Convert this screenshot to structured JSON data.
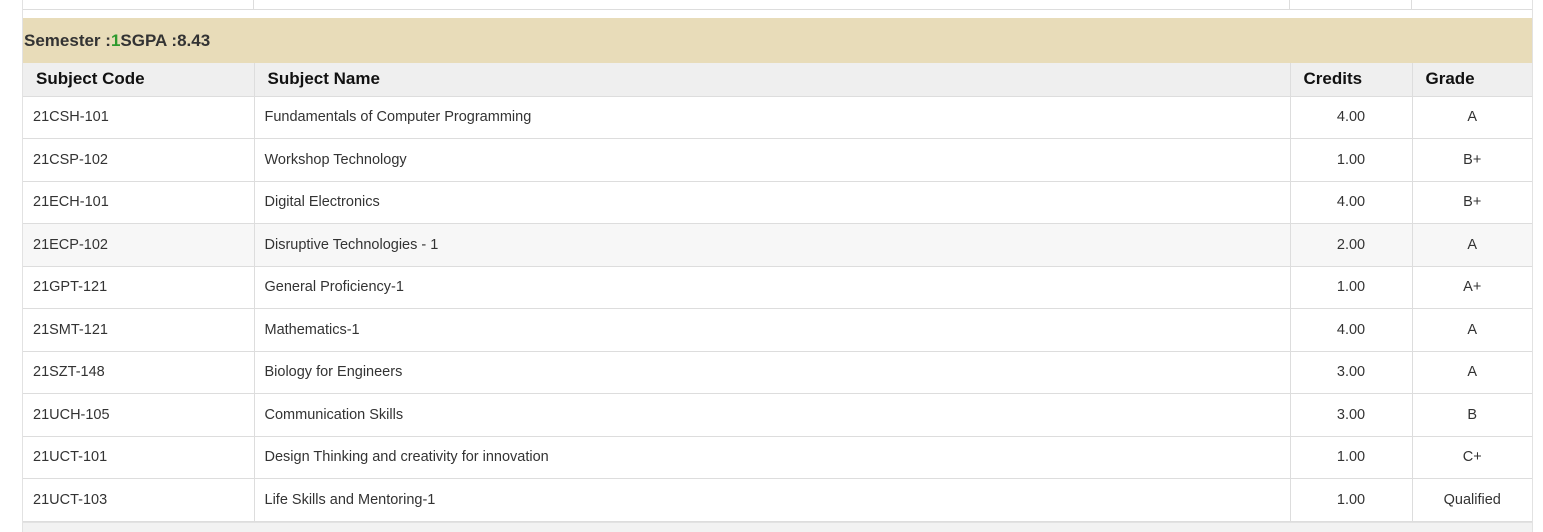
{
  "semester": {
    "label": "Semester : ",
    "number": "1",
    "sgpa_label": " SGPA : ",
    "sgpa_value": "8.43"
  },
  "table": {
    "headers": {
      "code": "Subject Code",
      "name": "Subject Name",
      "credits": "Credits",
      "grade": "Grade"
    },
    "rows": [
      {
        "code": "21CSH-101",
        "name": "Fundamentals of Computer Programming",
        "credits": "4.00",
        "grade": "A"
      },
      {
        "code": "21CSP-102",
        "name": "Workshop Technology",
        "credits": "1.00",
        "grade": "B+"
      },
      {
        "code": "21ECH-101",
        "name": "Digital Electronics",
        "credits": "4.00",
        "grade": "B+"
      },
      {
        "code": "21ECP-102",
        "name": "Disruptive Technologies - 1",
        "credits": "2.00",
        "grade": "A"
      },
      {
        "code": "21GPT-121",
        "name": "General Proficiency-1",
        "credits": "1.00",
        "grade": "A+"
      },
      {
        "code": "21SMT-121",
        "name": "Mathematics-1",
        "credits": "4.00",
        "grade": "A"
      },
      {
        "code": "21SZT-148",
        "name": "Biology for Engineers",
        "credits": "3.00",
        "grade": "A"
      },
      {
        "code": "21UCH-105",
        "name": "Communication Skills",
        "credits": "3.00",
        "grade": "B"
      },
      {
        "code": "21UCT-101",
        "name": "Design Thinking and creativity for innovation",
        "credits": "1.00",
        "grade": "C+"
      },
      {
        "code": "21UCT-103",
        "name": "Life Skills and Mentoring-1",
        "credits": "1.00",
        "grade": "Qualified"
      }
    ]
  },
  "colors": {
    "header_band": "#e8dcb9",
    "semester_number": "#2e9a2e",
    "column_header_bg": "#efefef",
    "hover_row_bg": "#f7f7f7"
  }
}
